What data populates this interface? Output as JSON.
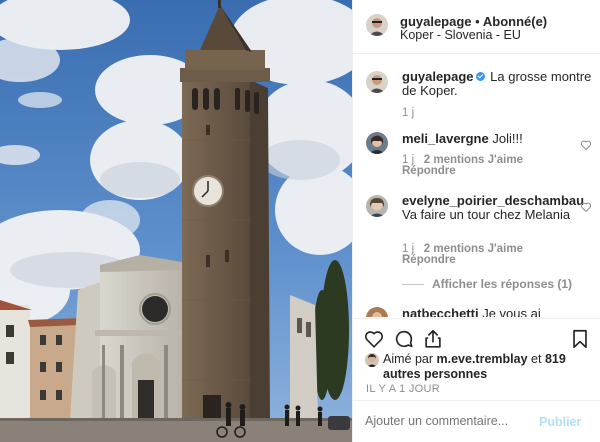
{
  "post": {
    "author": "guyalepage",
    "separator": "•",
    "follow_status": "Abonné(e)",
    "location": "Koper - Slovenia - EU",
    "caption_user": "guyalepage",
    "caption_text": "La grosse montre de Koper.",
    "caption_time": "1 j"
  },
  "comments": [
    {
      "user": "meli_lavergne",
      "text": "Joli!!!",
      "time": "1 j",
      "likes": "2 mentions J'aime",
      "reply": "Répondre"
    },
    {
      "user": "evelyne_poirier_deschambault",
      "user_visible": "evelyne_poirier_deschambau",
      "text": "Va faire un tour chez Melania",
      "time": "1 j",
      "likes": "2 mentions J'aime",
      "reply": "Répondre",
      "view_replies": "Afficher les réponses (1)"
    },
    {
      "user": "natbecchetti",
      "text": "Je vous ai"
    }
  ],
  "likes": {
    "prefix": "Aimé par",
    "user": "m.eve.tremblay",
    "connector": "et",
    "others": "819 autres personnes"
  },
  "timestamp": "IL Y A 1 JOUR",
  "add_comment": {
    "placeholder": "Ajouter un commentaire...",
    "publish_label": "Publier"
  },
  "colors": {
    "link_blue": "#3897f0",
    "publish_disabled": "#b2dffc",
    "muted": "#8e8e8e",
    "text": "#262626"
  },
  "icons": [
    "heart-icon",
    "comment-icon",
    "share-icon",
    "bookmark-icon",
    "verified-icon"
  ]
}
